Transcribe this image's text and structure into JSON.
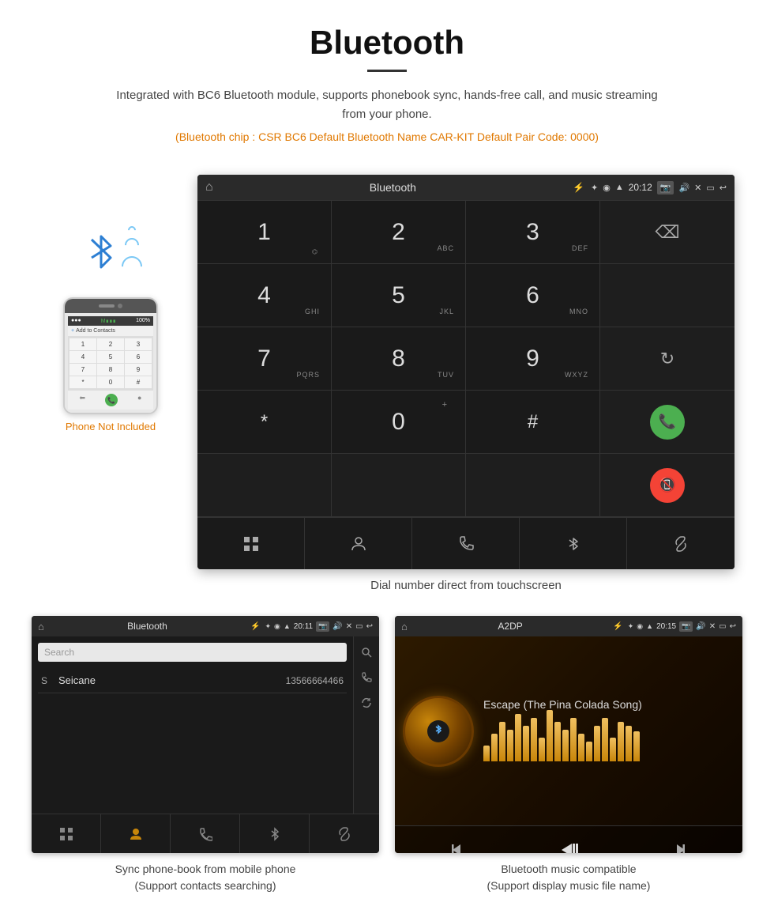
{
  "page": {
    "title": "Bluetooth",
    "description": "Integrated with BC6 Bluetooth module, supports phonebook sync, hands-free call, and music streaming from your phone.",
    "specs": "(Bluetooth chip : CSR BC6    Default Bluetooth Name CAR-KIT    Default Pair Code: 0000)",
    "main_caption": "Dial number direct from touchscreen",
    "bottom_left_caption_line1": "Sync phone-book from mobile phone",
    "bottom_left_caption_line2": "(Support contacts searching)",
    "bottom_right_caption_line1": "Bluetooth music compatible",
    "bottom_right_caption_line2": "(Support display music file name)"
  },
  "car_screen": {
    "title": "Bluetooth",
    "time": "20:12",
    "keys": [
      {
        "main": "1",
        "sub": ""
      },
      {
        "main": "2",
        "sub": "ABC"
      },
      {
        "main": "3",
        "sub": "DEF"
      },
      {
        "main": "",
        "sub": ""
      },
      {
        "main": "4",
        "sub": "GHI"
      },
      {
        "main": "5",
        "sub": "JKL"
      },
      {
        "main": "6",
        "sub": "MNO"
      },
      {
        "main": "",
        "sub": ""
      },
      {
        "main": "7",
        "sub": "PQRS"
      },
      {
        "main": "8",
        "sub": "TUV"
      },
      {
        "main": "9",
        "sub": "WXYZ"
      },
      {
        "main": "",
        "sub": ""
      },
      {
        "main": "*",
        "sub": ""
      },
      {
        "main": "0",
        "sub": "+"
      },
      {
        "main": "#",
        "sub": ""
      },
      {
        "main": "",
        "sub": ""
      }
    ],
    "bottom_icons": [
      "grid",
      "person",
      "phone",
      "bluetooth",
      "link"
    ]
  },
  "phonebook_screen": {
    "title": "Bluetooth",
    "time": "20:11",
    "search_placeholder": "Search",
    "contact_letter": "S",
    "contact_name": "Seicane",
    "contact_number": "13566664466",
    "right_icons": [
      "search",
      "phone",
      "refresh"
    ]
  },
  "music_screen": {
    "title": "A2DP",
    "time": "20:15",
    "song_title": "Escape (The Pina Colada Song)",
    "eq_bars": [
      20,
      35,
      50,
      40,
      60,
      45,
      55,
      30,
      65,
      50,
      40,
      55,
      35,
      25,
      45,
      55,
      30,
      50,
      45,
      38
    ]
  },
  "phone_mockup": {
    "label": "Phone Not Included",
    "keys": [
      "1",
      "2",
      "3",
      "4",
      "5",
      "6",
      "7",
      "8",
      "9",
      "*",
      "0",
      "#"
    ]
  },
  "colors": {
    "orange": "#e07800",
    "green": "#4caf50",
    "red": "#f44336",
    "blue_bt": "#2d7fd3"
  }
}
